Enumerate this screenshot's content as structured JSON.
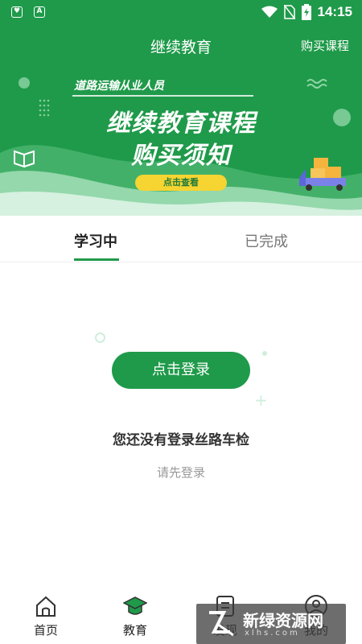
{
  "status_bar": {
    "time": "14:15",
    "left_icons": [
      "shield-icon",
      "a-badge-icon"
    ],
    "right_icons": [
      "wifi-icon",
      "no-sim-icon",
      "battery-charging-icon"
    ]
  },
  "header": {
    "title": "继续教育",
    "buy_link": "购买课程"
  },
  "banner": {
    "subtitle": "道路运输从业人员",
    "main_line1": "继续教育课程",
    "main_line2": "购买须知",
    "button_label": "点击查看",
    "button_color": "#f6d431"
  },
  "tabs": [
    {
      "label": "学习中",
      "active": true
    },
    {
      "label": "已完成",
      "active": false
    }
  ],
  "empty_state": {
    "login_button": "点击登录",
    "message": "您还没有登录丝路车检",
    "hint": "请先登录"
  },
  "bottom_nav": [
    {
      "label": "首页",
      "icon": "home-icon",
      "active": false
    },
    {
      "label": "教育",
      "icon": "graduation-cap-icon",
      "active": true
    },
    {
      "label": "发现",
      "icon": "discover-icon",
      "active": false
    },
    {
      "label": "我的",
      "icon": "profile-icon",
      "active": false
    }
  ],
  "watermark": {
    "text": "新绿资源网",
    "sub": "xlhs.com"
  },
  "colors": {
    "accent": "#1f9a4a",
    "banner_button": "#f6d431"
  }
}
